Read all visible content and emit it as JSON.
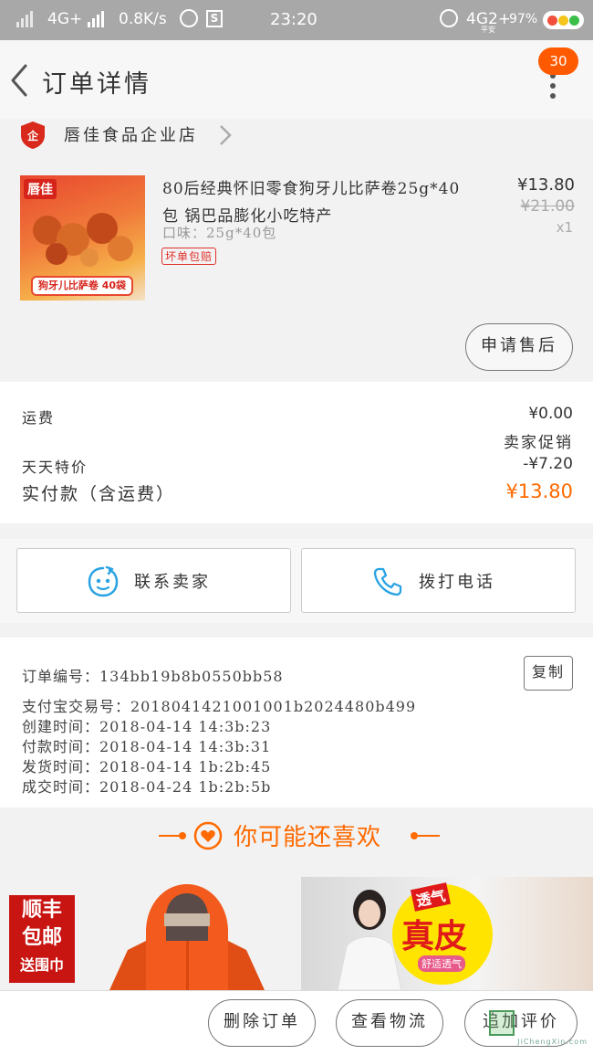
{
  "status_bar": {
    "network": "4G+",
    "speed": "0.8K/s",
    "s_icon": "S",
    "time": "23:20",
    "network2": "4G2+",
    "battery": "97%",
    "sim_note": "平安"
  },
  "header": {
    "title": "订单详情",
    "badge": "30"
  },
  "shop": {
    "name": "唇佳食品企业店"
  },
  "product": {
    "name": "80后经典怀旧零食狗牙儿比萨卷25g*40包 锅巴品膨化小吃特产",
    "spec": "口味：25g*40包",
    "tag": "坏单包赔",
    "price": "¥13.80",
    "original_price": "¥21.00",
    "quantity": "x1",
    "after_sale_label": "申请售后",
    "thumb_brand": "唇佳",
    "thumb_caption": "狗牙儿比萨卷 40袋"
  },
  "fees": {
    "shipping_label": "运费",
    "shipping_value": "¥0.00",
    "promo_label": "卖家促销",
    "special_label": "天天特价",
    "special_value": "-¥7.20",
    "paid_label": "实付款（含运费）",
    "paid_value": "¥13.80"
  },
  "contact": {
    "seller_label": "联系卖家",
    "call_label": "拨打电话"
  },
  "order_info": {
    "order_no": "订单编号：134bb19b8b0550bb58",
    "copy_label": "复制",
    "alipay_no": "支付宝交易号：2018041421001001b2024480b499",
    "created": "创建时间：2018-04-14 14:3b:23",
    "paid": "付款时间：2018-04-14 14:3b:31",
    "shipped": "发货时间：2018-04-14 1b:2b:45",
    "completed": "成交时间：2018-04-24 1b:2b:5b"
  },
  "recommend": {
    "title": "你可能还喜欢",
    "tile1_line1": "顺丰",
    "tile1_line2": "包邮",
    "tile1_line3": "送围巾",
    "tile2_tag": "透气",
    "tile2_big": "真皮",
    "tile2_small": "舒适透气"
  },
  "bottom_bar": {
    "delete_label": "删除订单",
    "logistics_label": "查看物流",
    "review_label": "追加评价"
  },
  "watermark": "JiChengXin.com",
  "colors": {
    "accent": "#ff6a00",
    "badge": "#ff5a00",
    "tag_red": "#e0312c",
    "icon_blue": "#29a3e3"
  }
}
